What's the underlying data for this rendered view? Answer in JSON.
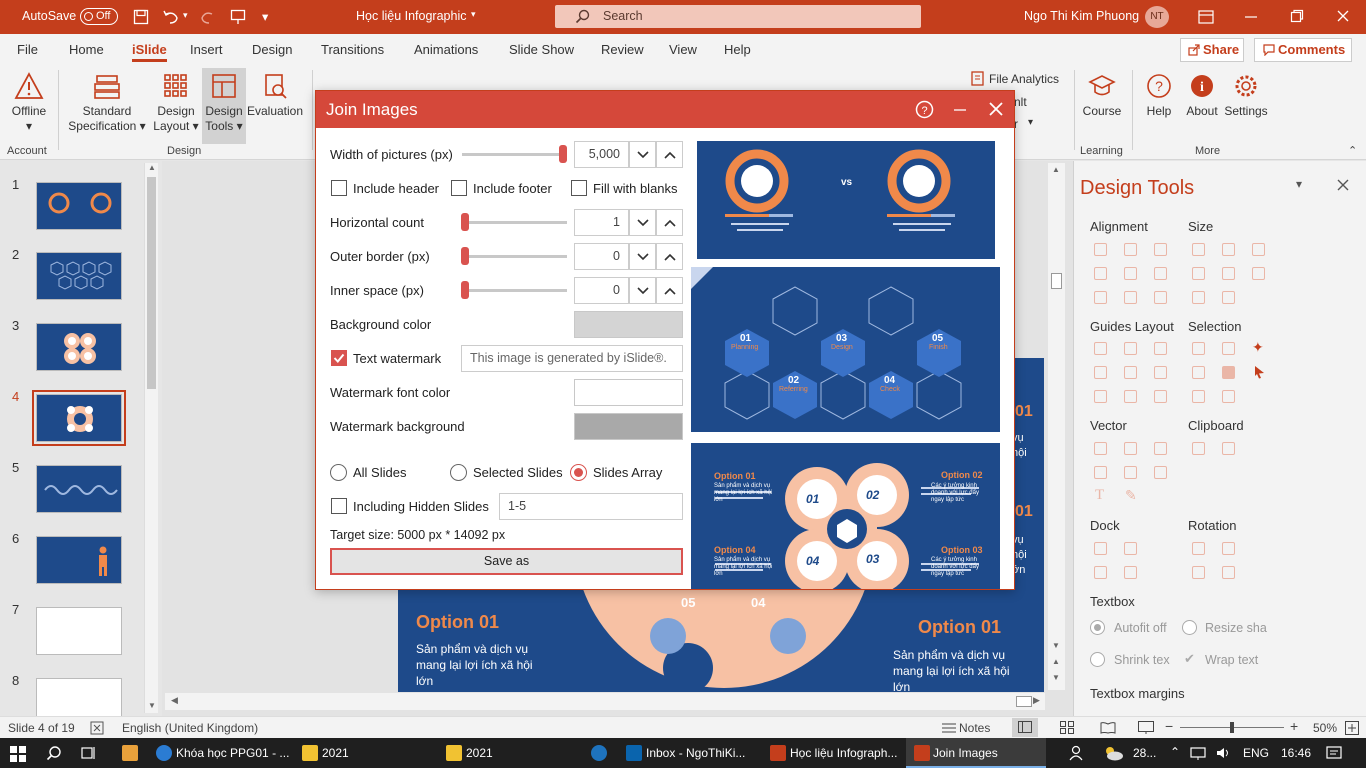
{
  "colors": {
    "accent": "#c43e1c",
    "dialog_header": "#d5483a",
    "slide_blue": "#1e4a8a",
    "peach": "#f7c1a4",
    "orange": "#f0894a"
  },
  "titlebar": {
    "autosave": "AutoSave",
    "autosave_state": "Off",
    "doc_title": "Học liệu Infographic",
    "search": "Search",
    "user": "Ngo Thi Kim Phuong",
    "initials": "NT"
  },
  "menu": {
    "tabs": [
      "File",
      "Home",
      "iSlide",
      "Insert",
      "Design",
      "Transitions",
      "Animations",
      "Slide Show",
      "Review",
      "View",
      "Help"
    ],
    "share": "Share",
    "comments": "Comments"
  },
  "ribbon": {
    "offline": "Offline",
    "standard": "Standard",
    "specification": "Specification",
    "design": "Design",
    "layout": "Layout",
    "tools": "Tools",
    "evaluation": "Evaluation",
    "file_analytics": "File Analytics",
    "frag1": "nlt",
    "frag2": "r",
    "course": "Course",
    "help": "Help",
    "about": "About",
    "settings": "Settings",
    "groups": {
      "account": "Account",
      "design": "Design",
      "learning": "Learning",
      "more": "More"
    }
  },
  "thumbs": {
    "numbers": [
      "1",
      "2",
      "3",
      "4",
      "5",
      "6",
      "7",
      "8"
    ],
    "selected_index": 4
  },
  "dialog": {
    "title": "Join Images",
    "width_label": "Width of pictures (px)",
    "width_value": "5,000",
    "width_fraction": 1.0,
    "include_header": "Include header",
    "include_footer": "Include footer",
    "fill_blanks": "Fill with blanks",
    "hcount_label": "Horizontal count",
    "hcount_value": "1",
    "outer_label": "Outer border (px)",
    "outer_value": "0",
    "inner_label": "Inner space (px)",
    "inner_value": "0",
    "bg_label": "Background color",
    "text_watermark": "Text watermark",
    "watermark_placeholder": "This image is generated by iSlide®.",
    "wm_font_color": "Watermark font color",
    "wm_background": "Watermark background",
    "all_slides": "All Slides",
    "selected_slides": "Selected Slides",
    "slides_array": "Slides Array",
    "hidden_slides": "Including Hidden Slides",
    "range": "1-5",
    "target_size": "Target size:  5000 px *  14092 px",
    "save_as": "Save as"
  },
  "preview": {
    "p1_vs": "vs",
    "p2": {
      "labels": [
        "01",
        "02",
        "03",
        "04",
        "05"
      ],
      "titles": [
        "Planning",
        "Referring",
        "Design",
        "Check",
        "Finish"
      ]
    },
    "p3": {
      "options": [
        "Option 01",
        "Option 02",
        "Option 04",
        "Option 03"
      ],
      "nums": [
        "01",
        "02",
        "04",
        "03"
      ],
      "text1": "Sản phẩm và dịch vụ mang lại lợi ích xã hội lớn",
      "text2": "Các ý tưởng kinh doanh với lực đẩy ngay lập tức"
    }
  },
  "slide": {
    "option_left": "Option 01",
    "option_right": "Option 01",
    "text_left": "Sản phẩm và dịch vụ mang lại lợi ích xã hội lớn",
    "text_right": "Sản phẩm và dịch vụ mang lại lợi ích xã hội lớn",
    "num05": "05",
    "num04": "04",
    "side1": "01",
    "side2": "01",
    "frag_vu": "vụ",
    "frag_hoi": "hội",
    "frag_lon": "ớn"
  },
  "designtools": {
    "title": "Design Tools",
    "alignment": "Alignment",
    "size": "Size",
    "guides": "Guides Layout",
    "selection": "Selection",
    "vector": "Vector",
    "clipboard": "Clipboard",
    "dock": "Dock",
    "rotation": "Rotation",
    "textbox": "Textbox",
    "autofit": "Autofit off",
    "resize": "Resize sha",
    "shrink": "Shrink tex",
    "wrap": "Wrap text",
    "margins": "Textbox margins"
  },
  "status": {
    "slide": "Slide 4 of 19",
    "language": "English (United Kingdom)",
    "notes": "Notes",
    "zoom": "50%",
    "zoom_fraction": 0.5
  },
  "taskbar": {
    "items": [
      "Khóa học PPG01 - ...",
      "2021",
      "2021",
      "Inbox - NgoThiKi...",
      "Học liệu Infograph...",
      "Join Images"
    ],
    "weather": "28...",
    "lang": "ENG",
    "time": "16:46"
  }
}
